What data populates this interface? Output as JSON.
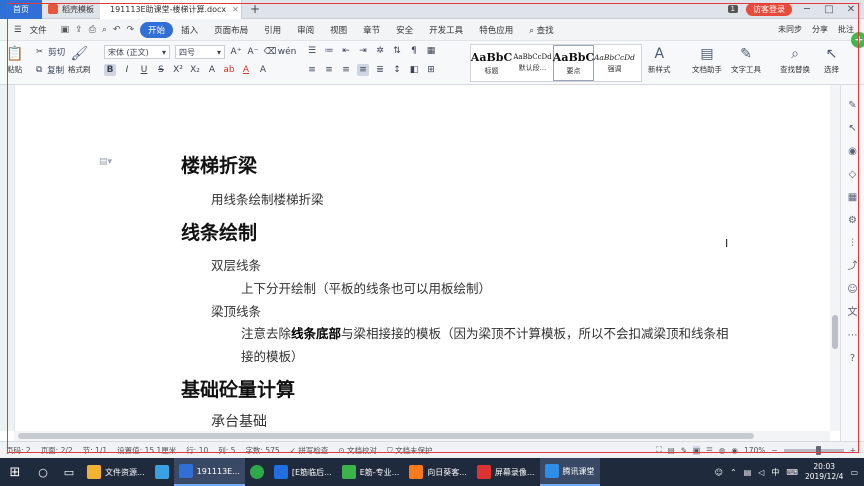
{
  "tabs": {
    "home": "首页",
    "template": "稻壳模板",
    "document": "191113E助课堂-楼梯计算.docx",
    "new_tab": "+",
    "badge": "1",
    "login": "访客登录"
  },
  "menu": {
    "file": "文件",
    "items": [
      "开始",
      "插入",
      "页面布局",
      "引用",
      "审阅",
      "视图",
      "章节",
      "安全",
      "开发工具",
      "特色应用"
    ],
    "search": "查找",
    "right": [
      "未同步",
      "分享",
      "批注"
    ]
  },
  "ribbon": {
    "paste": "粘贴",
    "cut": "剪切",
    "copy": "复制",
    "format_painter": "格式刷",
    "font_name": "宋体 (正文)",
    "font_size": "四号",
    "styles": [
      {
        "sample": "AaBbC",
        "label": "标题"
      },
      {
        "sample": "AaBbCcDd",
        "label": "默认段..."
      },
      {
        "sample": "AaBbC",
        "label": "要点"
      },
      {
        "sample": "AaBbCcDd",
        "label": "强调"
      }
    ],
    "new_style": "新样式",
    "doc_assistant": "文档助手",
    "text_tools": "文字工具",
    "find_replace": "查找替换",
    "select": "选择"
  },
  "document": {
    "h1_stair": "楼梯折梁",
    "stair_line": "用线条绘制楼梯折梁",
    "h1_line": "线条绘制",
    "double_line": "双层线条",
    "double_detail": "上下分开绘制（平板的线条也可以用板绘制）",
    "beam_top": "梁顶线条",
    "note_pre": "注意去除",
    "note_bold": "线条底部",
    "note_post": "与梁相接接的模板（因为梁顶不计算模板，所以不会扣减梁顶和线条相",
    "note_cont": "接的模板）",
    "h1_found": "基础砼量计算",
    "pile_cap": "承台基础"
  },
  "status": {
    "page_no": "页码: 2",
    "page": "页面: 2/2",
    "section": "节: 1/1",
    "settings": "设置值: 15.1厘米",
    "row": "行: 10",
    "col": "列: 5",
    "words": "字数: 575",
    "spell": "拼写检查",
    "doc_check": "文档校对",
    "unprotected": "文档未保护",
    "zoom": "170%"
  },
  "taskbar": {
    "apps": [
      {
        "label": "文件资源...",
        "color": "#f2b233"
      },
      {
        "label": "",
        "color": "#3aa0e6"
      },
      {
        "label": "191113E...",
        "color": "#2f6fd6"
      },
      {
        "label": "",
        "color": "#2eaa4b"
      },
      {
        "label": "[E筋临后...",
        "color": "#1f6fe0"
      },
      {
        "label": "E筋-专业...",
        "color": "#3cb44b"
      },
      {
        "label": "向日葵客...",
        "color": "#ff7a1a"
      },
      {
        "label": "屏幕录像...",
        "color": "#dd3333"
      },
      {
        "label": "腾讯课堂",
        "color": "#2e8fe8"
      }
    ],
    "lang": "中",
    "time": "20:03",
    "date": "2019/12/4"
  }
}
